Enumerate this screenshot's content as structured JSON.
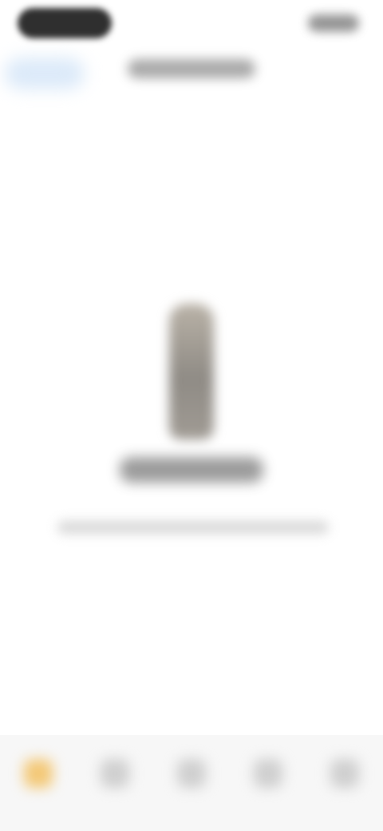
{
  "status_bar": {
    "time": "",
    "indicators": ""
  },
  "header": {
    "back_label": "",
    "title": ""
  },
  "empty_state": {
    "illustration": "empty-illustration",
    "title": "",
    "subtitle": ""
  },
  "bottom_nav": {
    "items": [
      {
        "label": "",
        "icon": "home-icon",
        "active": true,
        "color": "#f3c877"
      },
      {
        "label": "",
        "icon": "tab-icon-2",
        "active": false,
        "color": "#cfcfcf"
      },
      {
        "label": "",
        "icon": "tab-icon-3",
        "active": false,
        "color": "#cfcfcf"
      },
      {
        "label": "",
        "icon": "tab-icon-4",
        "active": false,
        "color": "#cfcfcf"
      },
      {
        "label": "",
        "icon": "tab-icon-5",
        "active": false,
        "color": "#cfcfcf"
      }
    ]
  }
}
